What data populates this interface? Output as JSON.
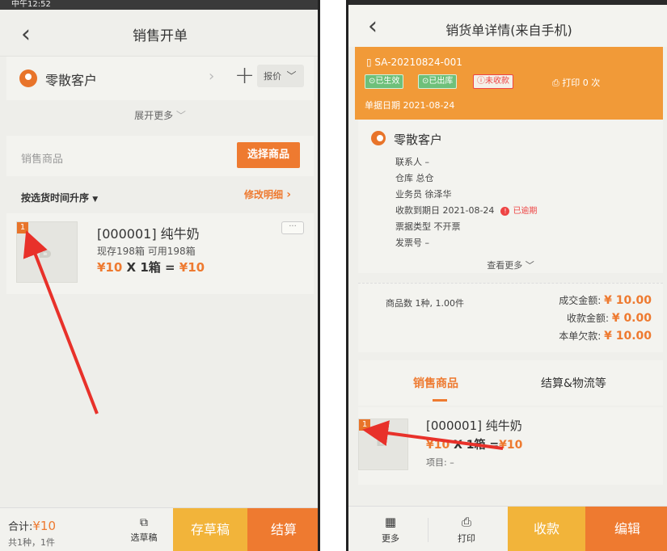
{
  "left": {
    "status_time": "中午12:52",
    "title": "销售开单",
    "customer": "零散客户",
    "quote": "报价",
    "expand_more": "展开更多",
    "goods_label": "销售商品",
    "select_goods": "选择商品",
    "sort_label": "按选货时间升序",
    "modify_detail": "修改明细",
    "item": {
      "index": "1",
      "name": "[000001] 纯牛奶",
      "stock": "现存198箱   可用198箱",
      "price_unit": "¥10",
      "qty": " X 1箱 = ",
      "price_total": "¥10"
    },
    "footer": {
      "total_label": "合计:",
      "total_value": "¥10",
      "total_count": "共1种，1件",
      "pick_draft": "选草稿",
      "save_draft": "存草稿",
      "settle": "结算"
    }
  },
  "right": {
    "title": "销货单详情(来自手机)",
    "doc_no": "SA-20210824-001",
    "badges": [
      "已生效",
      "已出库",
      "未收款"
    ],
    "print_count": "打印 0 次",
    "doc_date": "单据日期 2021-08-24",
    "customer": "零散客户",
    "contact": "联系人  –",
    "warehouse": "仓库  总仓",
    "salesman": "业务员  徐泽华",
    "due_date": "收款到期日  2021-08-24",
    "overdue": "已逾期",
    "ticket_type": "票据类型  不开票",
    "invoice_no": "发票号  –",
    "view_more": "查看更多",
    "goods_count": "商品数  1种, 1.00件",
    "deal_amount_label": "成交金额:",
    "deal_amount": "¥ 10.00",
    "received_label": "收款金额:",
    "received": "¥ 0.00",
    "owed_label": "本单欠款:",
    "owed": "¥ 10.00",
    "tab_goods": "销售商品",
    "tab_settle": "结算&物流等",
    "item": {
      "index": "1",
      "name": "[000001] 纯牛奶",
      "price": "¥10",
      "qty": " X 1箱 =",
      "total": "¥10",
      "project": "项目: –"
    },
    "footer": {
      "more": "更多",
      "print": "打印",
      "collect": "收款",
      "edit": "编辑"
    }
  },
  "colors": {
    "accent_orange": "#ee7a30",
    "accent_yellow": "#f2b43a",
    "banner": "#f19a38",
    "annotation_red": "#e8312a"
  }
}
